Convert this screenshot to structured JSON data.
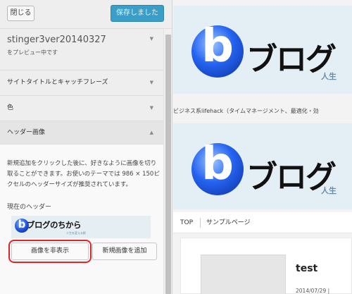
{
  "sidebar": {
    "close_label": "閉じる",
    "saved_label": "保存しました",
    "theme_name": "stinger3ver20140327",
    "theme_sub": "をプレビュー中です",
    "sections": [
      {
        "label": "サイトタイトルとキャッチフレーズ"
      },
      {
        "label": "色"
      },
      {
        "label": "ヘッダー画像"
      }
    ],
    "header_panel": {
      "description": "新規追加をクリックした後に、好きなように画像を切り取ることができます。お使いのテーマでは 986 × 150ピクセルのヘッダーサイズが推奨されています。",
      "current_label": "現在のヘッダー",
      "thumb_logo_letter": "b",
      "thumb_logo_text": "ブログのちから",
      "thumb_logo_sub": "人生を変える術",
      "hide_button": "画像を非表示",
      "add_button": "新規画像を追加"
    }
  },
  "preview": {
    "logo_letter": "b",
    "logo_text": "ブログ",
    "logo_sub": "人生",
    "tagline": "ビジネス系lifehack（タイムマネージメント、最適化・効",
    "nav": [
      "TOP",
      "サンプルページ"
    ],
    "post_title": "test",
    "post_date": "2014/07/29 |"
  },
  "colors": {
    "accent": "#3a9ec8",
    "highlight": "#e0242a",
    "header_bg": "#e3eff5"
  }
}
